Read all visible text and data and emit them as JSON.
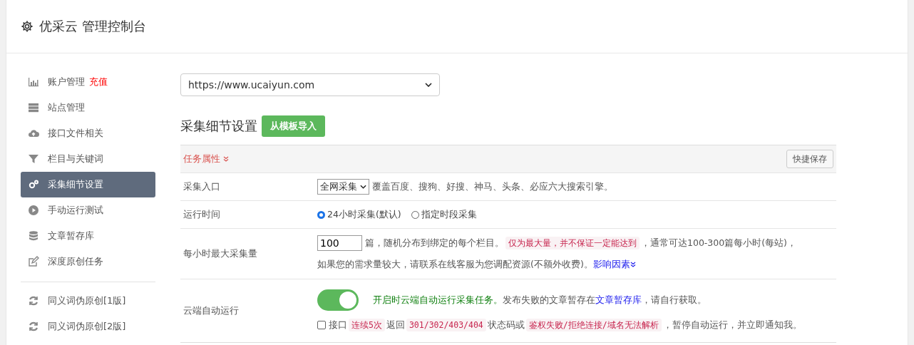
{
  "header": {
    "title": "优采云 管理控制台"
  },
  "sidebar": {
    "groups": [
      [
        {
          "kind": "chart",
          "label": "账户管理",
          "badge": "充值",
          "selected": false
        },
        {
          "kind": "server",
          "label": "站点管理",
          "selected": false
        },
        {
          "kind": "cloud",
          "label": "接口文件相关",
          "selected": false
        },
        {
          "kind": "filter",
          "label": "栏目与关键词",
          "selected": false
        },
        {
          "kind": "gear",
          "label": "采集细节设置",
          "selected": true
        },
        {
          "kind": "play",
          "label": "手动运行测试",
          "selected": false
        },
        {
          "kind": "database",
          "label": "文章暂存库",
          "selected": false
        },
        {
          "kind": "edit",
          "label": "深度原创任务",
          "selected": false
        }
      ],
      [
        {
          "kind": "refresh",
          "label": "同义词伪原创[1版]",
          "selected": false
        },
        {
          "kind": "refresh",
          "label": "同义词伪原创[2版]",
          "selected": false
        }
      ]
    ]
  },
  "site_select": {
    "value": "https://www.ucaiyun.com"
  },
  "section": {
    "title": "采集细节设置",
    "import_button": "从模板导入"
  },
  "panel": {
    "title": "任务属性",
    "save_button": "快捷保存",
    "rows": [
      {
        "kind": "entry",
        "label": "采集入口",
        "select_value": "全网采集",
        "note": "覆盖百度、搜狗、好搜、神马、头条、必应六大搜索引擎。"
      },
      {
        "kind": "radio",
        "label": "运行时间",
        "options": [
          {
            "label": "24小时采集(默认)",
            "selected": true
          },
          {
            "label": "指定时段采集",
            "selected": false
          }
        ]
      },
      {
        "kind": "quota",
        "label": "每小时最大采集量",
        "value": "100",
        "line1": [
          {
            "kind": "text",
            "text": "篇，随机分布到绑定的每个栏目。"
          },
          {
            "kind": "code",
            "text": "仅为最大量，并不保证一定能达到"
          },
          {
            "kind": "text",
            "text": "，通常可达100-300篇每小时(每站)，"
          }
        ],
        "line2": [
          {
            "kind": "text",
            "text": "如果您的需求量较大，请联系在线客服为您调配资源(不额外收费)。"
          },
          {
            "kind": "link",
            "text": "影响因素"
          }
        ]
      },
      {
        "kind": "auto",
        "label": "云端自动运行",
        "on": true,
        "line1": [
          {
            "kind": "green",
            "text": "开启时云端自动运行采集任务。"
          },
          {
            "kind": "text",
            "text": "发布失败的文章暂存在"
          },
          {
            "kind": "link",
            "text": "文章暂存库"
          },
          {
            "kind": "text",
            "text": "，请自行获取。"
          }
        ],
        "checked": false,
        "line2": [
          {
            "kind": "text",
            "text": "接口"
          },
          {
            "kind": "code",
            "text": "连续5次"
          },
          {
            "kind": "text",
            "text": "返回"
          },
          {
            "kind": "code",
            "text": "301/302/403/404"
          },
          {
            "kind": "text",
            "text": "状态码或"
          },
          {
            "kind": "code",
            "text": "鉴权失败/拒绝连接/域名无法解析"
          },
          {
            "kind": "text",
            "text": "，暂停自动运行，并立即通知我。"
          }
        ]
      }
    ]
  }
}
